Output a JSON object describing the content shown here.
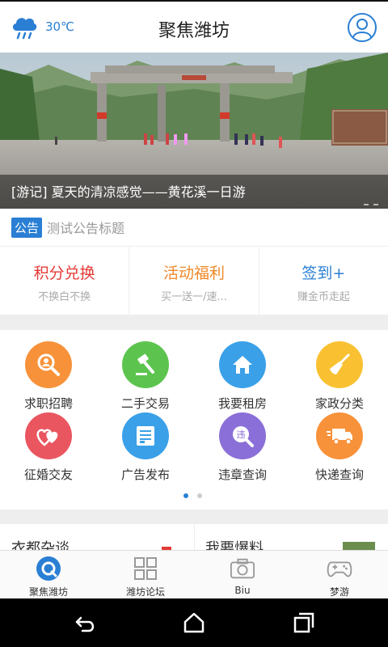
{
  "header": {
    "temperature": "30℃",
    "title": "聚焦潍坊",
    "weather_icon": "cloud-rain-icon",
    "avatar_icon": "user-avatar-icon"
  },
  "banner": {
    "caption": "[游记] 夏天的清凉感觉——黄花溪一日游"
  },
  "notice": {
    "badge": "公告",
    "text": "测试公告标题"
  },
  "quick_cards": [
    {
      "title": "积分兑换",
      "subtitle": "不换白不换",
      "color": "#e53935"
    },
    {
      "title": "活动福利",
      "subtitle": "买一送一/速...",
      "color": "#f0882a"
    },
    {
      "title": "签到+",
      "subtitle": "赚金币走起",
      "color": "#2a7fd4"
    }
  ],
  "services": [
    {
      "label": "求职招聘",
      "icon": "job-search-icon",
      "color": "#f7923a"
    },
    {
      "label": "二手交易",
      "icon": "hammer-icon",
      "color": "#5cc44e"
    },
    {
      "label": "我要租房",
      "icon": "house-icon",
      "color": "#3aa0e8"
    },
    {
      "label": "家政分类",
      "icon": "broom-icon",
      "color": "#f9c132"
    },
    {
      "label": "征婚交友",
      "icon": "hearts-icon",
      "color": "#ea5660"
    },
    {
      "label": "广告发布",
      "icon": "document-icon",
      "color": "#3aa0e8"
    },
    {
      "label": "违章查询",
      "icon": "violation-search-icon",
      "color": "#8a6fd8"
    },
    {
      "label": "快递查询",
      "icon": "truck-icon",
      "color": "#f7923a"
    }
  ],
  "peek": {
    "left_title": "衣都杂谈",
    "right_title": "我要爆料"
  },
  "tabs": [
    {
      "label": "聚焦潍坊",
      "icon": "focus-icon",
      "active": true
    },
    {
      "label": "潍坊论坛",
      "icon": "grid-icon",
      "active": false
    },
    {
      "label": "Biu",
      "icon": "camera-icon",
      "active": false
    },
    {
      "label": "梦游",
      "icon": "gamepad-icon",
      "active": false
    }
  ],
  "colors": {
    "accent": "#2a7fd4",
    "grid_page_active": "#2a7fd4"
  }
}
